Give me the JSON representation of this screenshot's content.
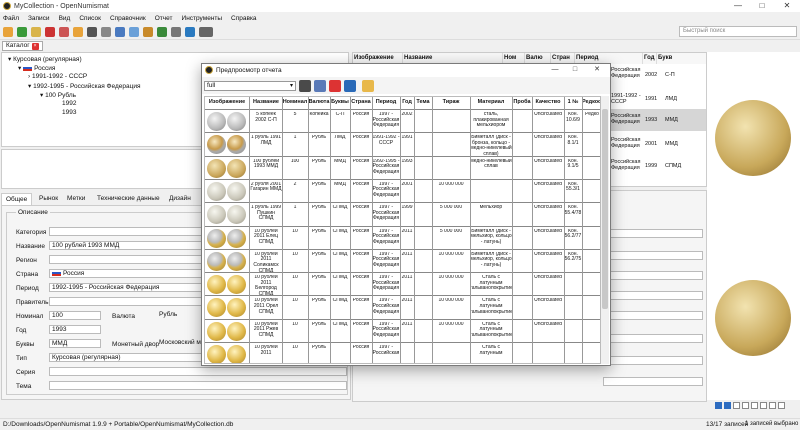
{
  "window": {
    "title": "MyCollection - OpenNumismat"
  },
  "menu": [
    "Файл",
    "Записи",
    "Вид",
    "Список",
    "Справочник",
    "Отчет",
    "Инструменты",
    "Справка"
  ],
  "search": {
    "placeholder": "Быстрый поиск"
  },
  "catalog_tab": {
    "label": "Каталог",
    "close": "×"
  },
  "tree": {
    "root": "Курсовая (регулярная)",
    "country": "Россия",
    "periods": [
      "1991-1992 - СССР",
      "1992-1995 - Российская Федерация"
    ],
    "value": "100 Рубль",
    "years": [
      "1992",
      "1993"
    ]
  },
  "detail_tabs": [
    "Общее",
    "Рынок",
    "Метки",
    "Технические данные",
    "Дизайн"
  ],
  "form": {
    "section": "Описание",
    "labels": {
      "category": "Категория",
      "title": "Название",
      "region": "Регион",
      "country": "Страна",
      "period": "Период",
      "ruler": "Правитель",
      "value": "Номинал",
      "currency": "Валюта",
      "year": "Год",
      "letters": "Буквы",
      "mint": "Монетный двор",
      "type": "Тип",
      "series": "Серия",
      "subject": "Тема"
    },
    "values": {
      "title": "100 рублей 1993 ММД",
      "country": "Россия",
      "period": "1992-1995 - Российская Федерация",
      "value": "100",
      "currency": "Рубль",
      "year": "1993",
      "letters": "ММД",
      "mint": "Московский мо",
      "type": "Курсовая (регулярная)"
    }
  },
  "main_table": {
    "headers": [
      "Изображение",
      "Название",
      "Ном",
      "Валю",
      "Стран",
      "Период",
      "Год",
      "Букв"
    ],
    "rows": [
      {
        "period": "Российская Федерация",
        "year": "2002",
        "letters": "С-П"
      },
      {
        "period": "1991-1992 - СССР",
        "year": "1991",
        "letters": "ЛМД"
      },
      {
        "period": "Российская Федерация",
        "year": "1993",
        "letters": "ММД"
      },
      {
        "period": "Российская Федерация",
        "year": "2001",
        "letters": "ММД"
      },
      {
        "period": "Российская Федерация",
        "year": "1999",
        "letters": "СПМД"
      }
    ]
  },
  "dialog": {
    "title": "Предпросмотр отчета",
    "template": "full",
    "headers": [
      "Изображение",
      "Название",
      "Номинал",
      "Валюта",
      "Буквы",
      "Страна",
      "Период",
      "Год",
      "Тема",
      "Тираж",
      "Материал",
      "Проба",
      "Качество",
      "1 №",
      "Редкость"
    ],
    "rows": [
      {
        "title": "5 копеек 2002 С-П",
        "value": "5",
        "currency": "Копейка",
        "letters": "С-П",
        "country": "Россия",
        "period": "1997 - Российская Федерация",
        "year": "2002",
        "mintage": "",
        "material": "сталь, плакированная мельхиором",
        "quality": "Uncirculated",
        "num": "Кон. 10.6/9",
        "rarity": "Редко",
        "coin": "steel"
      },
      {
        "title": "1 рубль 1991 ЛМД",
        "value": "1",
        "currency": "Рубль",
        "letters": "ЛМД",
        "country": "Россия",
        "period": "1991-1992 - СССР",
        "year": "1991",
        "mintage": "",
        "material": "Биметалл (диск - бронза, кольцо - медно-никелевый сплав)",
        "quality": "Uncirculated",
        "num": "Кон. 8.1/1",
        "rarity": "",
        "coin": "bimetal"
      },
      {
        "title": "100 рублей 1993 ММД",
        "value": "100",
        "currency": "Рубль",
        "letters": "ММД",
        "country": "Россия",
        "period": "1992-1995 - Российская Федерация",
        "year": "1993",
        "mintage": "",
        "material": "медно-никелевый сплав",
        "quality": "Uncirculated",
        "num": "Кон. 9.1/5",
        "rarity": "",
        "coin": "brass"
      },
      {
        "title": "2 рубля 2001 Гагарин ММД",
        "value": "2",
        "currency": "Рубль",
        "letters": "ММД",
        "country": "Россия",
        "period": "1997 - Российская Федерация",
        "year": "2001",
        "mintage": "10 000 000",
        "material": "",
        "quality": "Uncirculated",
        "num": "Кон. 55.3/1",
        "rarity": "",
        "coin": "silver"
      },
      {
        "title": "1 рубль 1999 Пушкин СПМД",
        "value": "1",
        "currency": "Рубль",
        "letters": "СПМД",
        "country": "Россия",
        "period": "1997 - Российская Федерация",
        "year": "1999",
        "mintage": "5 000 000",
        "material": "мельхиор",
        "quality": "Uncirculated",
        "num": "Кон. 55.4/78",
        "rarity": "",
        "coin": "silver"
      },
      {
        "title": "10 рублей 2011 Елец СПМД",
        "value": "10",
        "currency": "Рубль",
        "letters": "СПМД",
        "country": "Россия",
        "period": "1997 - Российская Федерация",
        "year": "2011",
        "mintage": "5 000 000",
        "material": "Биметалл (диск - мельхиор, кольцо - латунь)",
        "quality": "Uncirculated",
        "num": "Кон. 56.2/77",
        "rarity": "",
        "coin": "bimetal2"
      },
      {
        "title": "10 рублей 2011 Соликамск СПМД",
        "value": "10",
        "currency": "Рубль",
        "letters": "СПМД",
        "country": "Россия",
        "period": "1997 - Российская Федерация",
        "year": "2011",
        "mintage": "10 000 000",
        "material": "Биметалл (диск - мельхиор, кольцо - латунь)",
        "quality": "Uncirculated",
        "num": "Кон. 56.2/75",
        "rarity": "",
        "coin": "bimetal2"
      },
      {
        "title": "10 рублей 2011 Белгород СПМД",
        "value": "10",
        "currency": "Рубль",
        "letters": "СПМД",
        "country": "Россия",
        "period": "1997 - Российская Федерация",
        "year": "2011",
        "mintage": "10 000 000",
        "material": "Сталь с латунным гальванопокрытием",
        "quality": "Uncirculated",
        "num": "",
        "rarity": "",
        "coin": "gold"
      },
      {
        "title": "10 рублей 2011 Орел СПМД",
        "value": "10",
        "currency": "Рубль",
        "letters": "СПМД",
        "country": "Россия",
        "period": "1997 - Российская Федерация",
        "year": "2011",
        "mintage": "10 000 000",
        "material": "Сталь с латунным гальванопокрытием",
        "quality": "Uncirculated",
        "num": "",
        "rarity": "",
        "coin": "gold"
      },
      {
        "title": "10 рублей 2011 Ржев СПМД",
        "value": "10",
        "currency": "Рубль",
        "letters": "СПМД",
        "country": "Россия",
        "period": "1997 - Российская Федерация",
        "year": "2011",
        "mintage": "10 000 000",
        "material": "Сталь с латунным гальванопокрытием",
        "quality": "Uncirculated",
        "num": "",
        "rarity": "",
        "coin": "gold"
      },
      {
        "title": "10 рублей 2011",
        "value": "10",
        "currency": "Рубль",
        "letters": "",
        "country": "Россия",
        "period": "1997 - Российская",
        "year": "",
        "mintage": "",
        "material": "Сталь с латунным",
        "quality": "",
        "num": "",
        "rarity": "",
        "coin": "gold"
      }
    ]
  },
  "status": {
    "path": "D:/Downloads/OpenNumismat 1.9.9 + Portable/OpenNumismat/MyCollection.db",
    "count": "13/17 записей",
    "selected": "1 записей выбрано"
  },
  "colors": {
    "accent": "#2d6cc0",
    "gold": "#d9b44a",
    "steel": "#b8b8b8"
  }
}
